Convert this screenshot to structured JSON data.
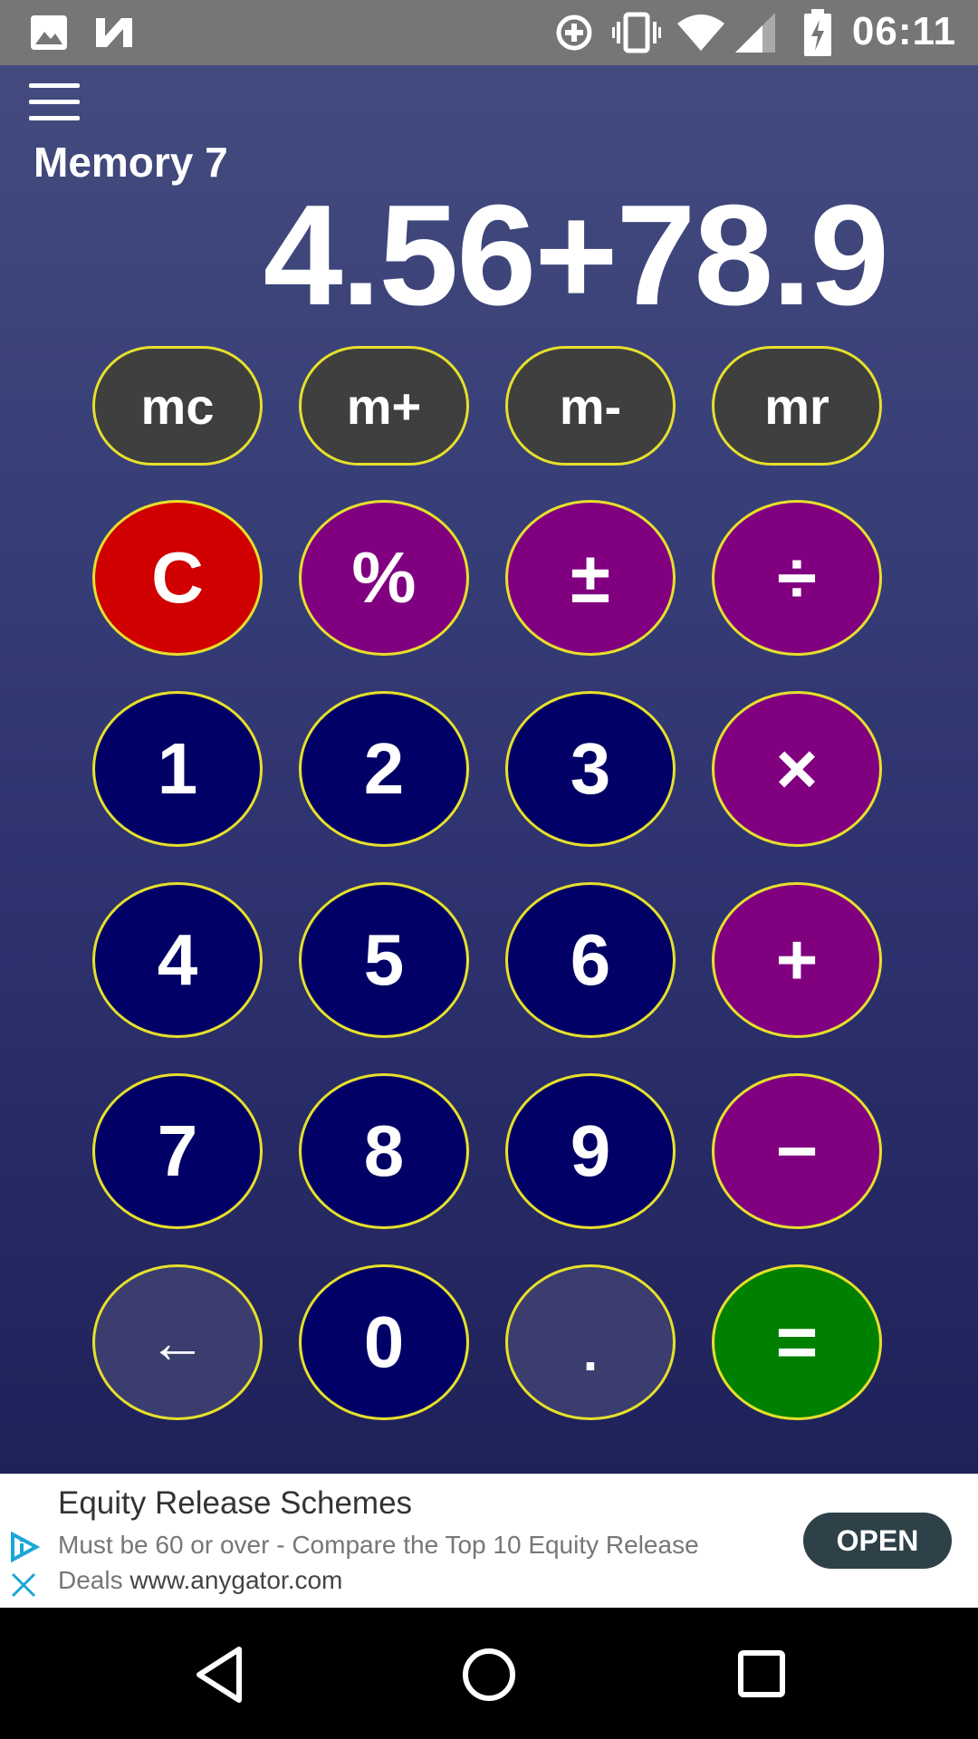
{
  "status_bar": {
    "time": "06:11",
    "icons": [
      "gallery-icon",
      "n-logo-icon",
      "data-saver-icon",
      "vibrate-icon",
      "wifi-icon",
      "signal-icon",
      "battery-charging-icon"
    ]
  },
  "header": {
    "menu_icon": "hamburger-menu-icon",
    "memory_label": "Memory 7",
    "display_value": "4.56+78.9"
  },
  "colors": {
    "memory_key": "#3f3f3f",
    "clear_key": "#d00000",
    "operator_key": "#800080",
    "digit_key": "#000066",
    "muted_key": "#3b3d6e",
    "equals_key": "#008000",
    "key_border": "#e6e02b"
  },
  "memory_keys": [
    {
      "label": "mc",
      "name": "mc-button"
    },
    {
      "label": "m+",
      "name": "m-plus-button"
    },
    {
      "label": "m-",
      "name": "m-minus-button"
    },
    {
      "label": "mr",
      "name": "mr-button"
    }
  ],
  "keypad": [
    [
      {
        "label": "C",
        "name": "clear-button",
        "kind": "clear"
      },
      {
        "label": "%",
        "name": "percent-button",
        "kind": "operator"
      },
      {
        "label": "±",
        "name": "plus-minus-button",
        "kind": "operator"
      },
      {
        "label": "÷",
        "name": "divide-button",
        "kind": "operator"
      }
    ],
    [
      {
        "label": "1",
        "name": "digit-1-button",
        "kind": "digit"
      },
      {
        "label": "2",
        "name": "digit-2-button",
        "kind": "digit"
      },
      {
        "label": "3",
        "name": "digit-3-button",
        "kind": "digit"
      },
      {
        "label": "×",
        "name": "multiply-button",
        "kind": "operator"
      }
    ],
    [
      {
        "label": "4",
        "name": "digit-4-button",
        "kind": "digit"
      },
      {
        "label": "5",
        "name": "digit-5-button",
        "kind": "digit"
      },
      {
        "label": "6",
        "name": "digit-6-button",
        "kind": "digit"
      },
      {
        "label": "+",
        "name": "add-button",
        "kind": "operator"
      }
    ],
    [
      {
        "label": "7",
        "name": "digit-7-button",
        "kind": "digit"
      },
      {
        "label": "8",
        "name": "digit-8-button",
        "kind": "digit"
      },
      {
        "label": "9",
        "name": "digit-9-button",
        "kind": "digit"
      },
      {
        "label": "−",
        "name": "subtract-button",
        "kind": "operator"
      }
    ],
    [
      {
        "label": "←",
        "name": "backspace-button",
        "kind": "muted"
      },
      {
        "label": "0",
        "name": "digit-0-button",
        "kind": "digit"
      },
      {
        "label": ".",
        "name": "decimal-button",
        "kind": "muted"
      },
      {
        "label": "=",
        "name": "equals-button",
        "kind": "equals"
      }
    ]
  ],
  "ad": {
    "title": "Equity Release Schemes",
    "body": "Must be 60 or over - Compare the Top 10 Equity Release Deals",
    "url": "www.anygator.com",
    "cta": "OPEN",
    "info_icon": "ad-choices-icon",
    "close_icon": "close-icon"
  },
  "nav_bar": {
    "back_icon": "back-triangle-icon",
    "home_icon": "home-circle-icon",
    "recents_icon": "recents-square-icon"
  }
}
